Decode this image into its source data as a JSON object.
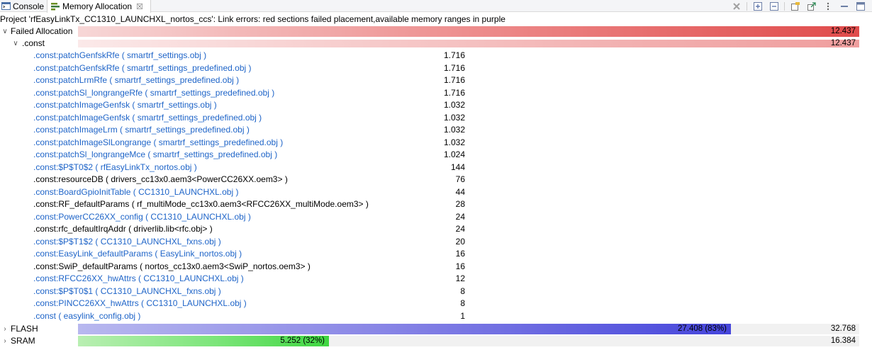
{
  "tabs": {
    "console_label": "Console",
    "memory_label": "Memory Allocation",
    "close_glyph": "☒"
  },
  "status_text": "Project 'rfEasyLinkTx_CC1310_LAUNCHXL_nortos_ccs': Link errors: red sections failed placement,available memory ranges in purple",
  "failed_allocation": {
    "label": "Failed Allocation",
    "total": "12.437",
    "fill_fraction": 1.0
  },
  "const_group": {
    "label": ".const",
    "total": "12.437",
    "fill_fraction": 1.0
  },
  "items": [
    {
      "name": ".const:patchGenfskRfe ( smartrf_settings.obj )",
      "value": "1.716",
      "linked": true
    },
    {
      "name": ".const:patchGenfskRfe ( smartrf_settings_predefined.obj )",
      "value": "1.716",
      "linked": true
    },
    {
      "name": ".const:patchLrmRfe ( smartrf_settings_predefined.obj )",
      "value": "1.716",
      "linked": true
    },
    {
      "name": ".const:patchSl_longrangeRfe ( smartrf_settings_predefined.obj )",
      "value": "1.716",
      "linked": true
    },
    {
      "name": ".const:patchImageGenfsk ( smartrf_settings.obj )",
      "value": "1.032",
      "linked": true
    },
    {
      "name": ".const:patchImageGenfsk ( smartrf_settings_predefined.obj )",
      "value": "1.032",
      "linked": true
    },
    {
      "name": ".const:patchImageLrm ( smartrf_settings_predefined.obj )",
      "value": "1.032",
      "linked": true
    },
    {
      "name": ".const:patchImageSlLongrange ( smartrf_settings_predefined.obj )",
      "value": "1.032",
      "linked": true
    },
    {
      "name": ".const:patchSl_longrangeMce ( smartrf_settings_predefined.obj )",
      "value": "1.024",
      "linked": true
    },
    {
      "name": ".const:$P$T0$2 ( rfEasyLinkTx_nortos.obj )",
      "value": "144",
      "linked": true
    },
    {
      "name": ".const:resourceDB ( drivers_cc13x0.aem3<PowerCC26XX.oem3> )",
      "value": "76",
      "linked": false
    },
    {
      "name": ".const:BoardGpioInitTable ( CC1310_LAUNCHXL.obj )",
      "value": "44",
      "linked": true
    },
    {
      "name": ".const:RF_defaultParams ( rf_multiMode_cc13x0.aem3<RFCC26XX_multiMode.oem3> )",
      "value": "28",
      "linked": false
    },
    {
      "name": ".const:PowerCC26XX_config ( CC1310_LAUNCHXL.obj )",
      "value": "24",
      "linked": true
    },
    {
      "name": ".const:rfc_defaultIrqAddr ( driverlib.lib<rfc.obj> )",
      "value": "24",
      "linked": false
    },
    {
      "name": ".const:$P$T1$2 ( CC1310_LAUNCHXL_fxns.obj )",
      "value": "20",
      "linked": true
    },
    {
      "name": ".const:EasyLink_defaultParams ( EasyLink_nortos.obj )",
      "value": "16",
      "linked": true
    },
    {
      "name": ".const:SwiP_defaultParams ( nortos_cc13x0.aem3<SwiP_nortos.oem3> )",
      "value": "16",
      "linked": false
    },
    {
      "name": ".const:RFCC26XX_hwAttrs ( CC1310_LAUNCHXL.obj )",
      "value": "12",
      "linked": true
    },
    {
      "name": ".const:$P$T0$1 ( CC1310_LAUNCHXL_fxns.obj )",
      "value": "8",
      "linked": true
    },
    {
      "name": ".const:PINCC26XX_hwAttrs ( CC1310_LAUNCHXL.obj )",
      "value": "8",
      "linked": true
    },
    {
      "name": ".const ( easylink_config.obj )",
      "value": "1",
      "linked": true
    }
  ],
  "flash": {
    "label": "FLASH",
    "used_label": "27.408 (83%)",
    "total": "32.768",
    "fill_fraction": 0.836
  },
  "sram": {
    "label": "SRAM",
    "used_label": "5.252 (32%)",
    "total": "16.384",
    "fill_fraction": 0.321
  },
  "colors": {
    "link_blue": "#1e64c8",
    "failed_red": "#e04b4b",
    "flash_purple": "#4545db",
    "sram_green": "#3ed640"
  }
}
